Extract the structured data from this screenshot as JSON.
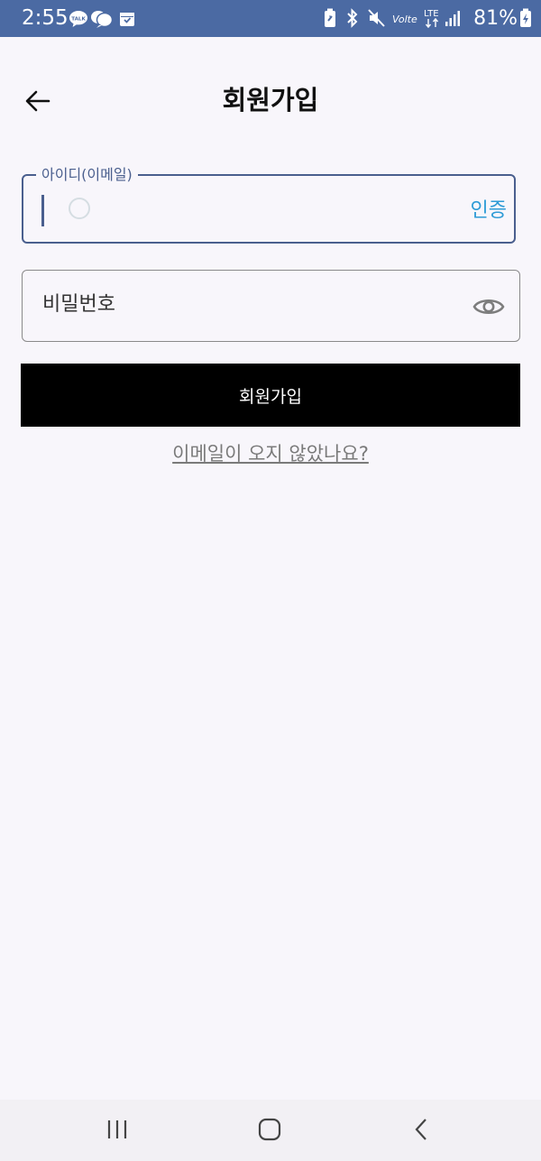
{
  "status_bar": {
    "time": "2:55",
    "battery_percent": "81%",
    "network_label": "LTE",
    "volte_label": "Volte",
    "left_icons": [
      "kakaotalk-icon",
      "chat-bubble-icon",
      "calendar-icon"
    ],
    "right_icons": [
      "battery-saver-icon",
      "bluetooth-icon",
      "mute-icon",
      "volte-icon",
      "lte-icon",
      "signal-icon",
      "battery-charging-icon"
    ],
    "kakao_label": "TALK"
  },
  "header": {
    "title": "회원가입",
    "back_icon": "arrow-left-icon"
  },
  "form": {
    "email": {
      "label": "아이디(이메일)",
      "value": "",
      "verify_label": "인증"
    },
    "password": {
      "placeholder": "비밀번호",
      "toggle_icon": "eye-icon"
    },
    "submit_label": "회원가입",
    "resend_link": "이메일이 오지 않았나요?"
  },
  "nav_bar": {
    "icons": [
      "recents-icon",
      "home-icon",
      "back-icon"
    ]
  },
  "colors": {
    "status_bar": "#4b6aa3",
    "field_focus": "#4a5f8e",
    "verify_link": "#2e9bd6",
    "primary_button": "#000000",
    "background": "#f8f6fb"
  }
}
